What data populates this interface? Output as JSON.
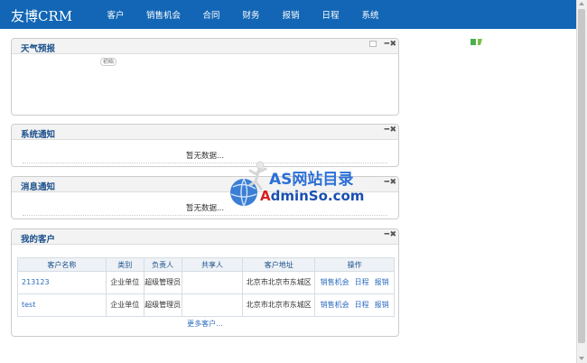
{
  "app": {
    "logo": "友博CRM"
  },
  "nav": [
    "客户",
    "销售机会",
    "合同",
    "财务",
    "报销",
    "日程",
    "系统"
  ],
  "panels": {
    "weather": {
      "title": "天气预报",
      "inner_tag": "初始"
    },
    "system_notice": {
      "title": "系统通知",
      "empty_text": "暂无数据..."
    },
    "messages": {
      "title": "消息通知",
      "empty_text": "暂无数据..."
    },
    "customers": {
      "title": "我的客户",
      "columns": [
        "客户名称",
        "类别",
        "负责人",
        "共享人",
        "客户地址",
        "操作"
      ],
      "rows": [
        {
          "name": "213123",
          "category": "企业单位",
          "owner": "超级管理员",
          "sharer": "",
          "address": "北京市北京市东城区",
          "ops": [
            "销售机会",
            "日程",
            "报销"
          ]
        },
        {
          "name": "test",
          "category": "企业单位",
          "owner": "超级管理员",
          "sharer": "",
          "address": "北京市北京市东城区",
          "ops": [
            "销售机会",
            "日程",
            "报销"
          ]
        }
      ],
      "more_text": "更多客户..."
    }
  },
  "watermark": {
    "line1": "AS网站目录",
    "line2_red": "A",
    "line2_rest": "dminSo.com"
  },
  "colors": {
    "topbar": "#1266b5",
    "panel_title": "#1a4f8b",
    "link": "#2a6bbd"
  }
}
